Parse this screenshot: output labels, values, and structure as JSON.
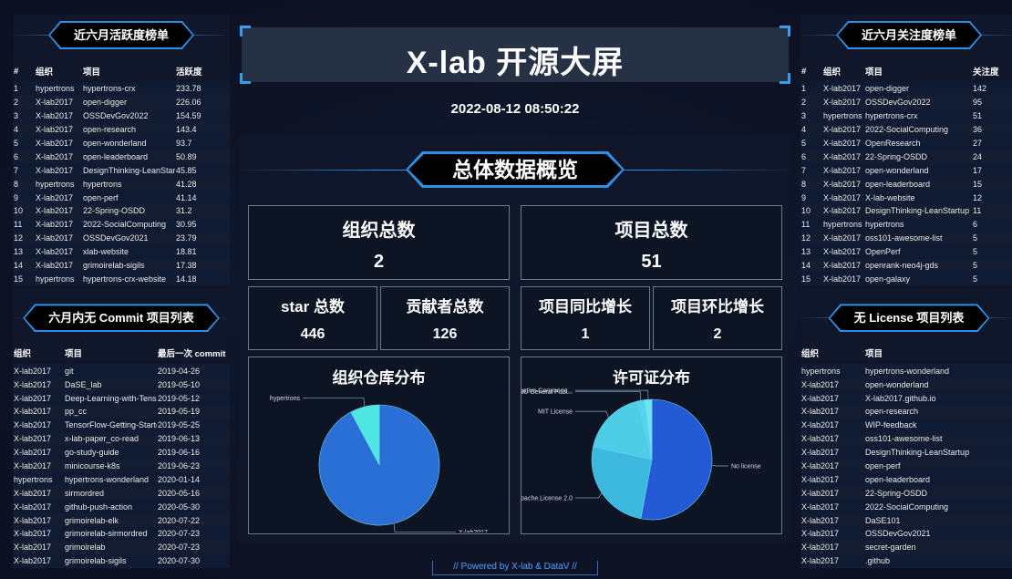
{
  "header": {
    "title": "X-lab 开源大屏",
    "timestamp": "2022-08-12 08:50:22"
  },
  "activity_rank": {
    "title": "近六月活跃度榜单",
    "columns": [
      "#",
      "组织",
      "项目",
      "活跃度"
    ],
    "rows": [
      [
        "1",
        "hypertrons",
        "hypertrons-crx",
        "233.78"
      ],
      [
        "2",
        "X-lab2017",
        "open-digger",
        "226.06"
      ],
      [
        "3",
        "X-lab2017",
        "OSSDevGov2022",
        "154.59"
      ],
      [
        "4",
        "X-lab2017",
        "open-research",
        "143.4"
      ],
      [
        "5",
        "X-lab2017",
        "open-wonderland",
        "93.7"
      ],
      [
        "6",
        "X-lab2017",
        "open-leaderboard",
        "50.89"
      ],
      [
        "7",
        "X-lab2017",
        "DesignThinking-LeanStartup",
        "45.85"
      ],
      [
        "8",
        "hypertrons",
        "hypertrons",
        "41.28"
      ],
      [
        "9",
        "X-lab2017",
        "open-perf",
        "41.14"
      ],
      [
        "10",
        "X-lab2017",
        "22-Spring-OSDD",
        "31.2"
      ],
      [
        "11",
        "X-lab2017",
        "2022-SocialComputing",
        "30.95"
      ],
      [
        "12",
        "X-lab2017",
        "OSSDevGov2021",
        "23.79"
      ],
      [
        "13",
        "X-lab2017",
        "xlab-website",
        "18.81"
      ],
      [
        "14",
        "X-lab2017",
        "grimoirelab-sigils",
        "17.38"
      ],
      [
        "15",
        "hypertrons",
        "hypertrons-crx-website",
        "14.18"
      ]
    ]
  },
  "no_commit": {
    "title": "六月内无 Commit 项目列表",
    "columns": [
      "组织",
      "项目",
      "最后一次 commit"
    ],
    "rows": [
      [
        "X-lab2017",
        "git",
        "2019-04-26"
      ],
      [
        "X-lab2017",
        "DaSE_lab",
        "2019-05-10"
      ],
      [
        "X-lab2017",
        "Deep-Learning-with-TensorFlow",
        "2019-05-12"
      ],
      [
        "X-lab2017",
        "pp_cc",
        "2019-05-19"
      ],
      [
        "X-lab2017",
        "TensorFlow-Getting-Started",
        "2019-05-25"
      ],
      [
        "X-lab2017",
        "x-lab-paper_co-read",
        "2019-06-13"
      ],
      [
        "X-lab2017",
        "go-study-guide",
        "2019-06-16"
      ],
      [
        "X-lab2017",
        "minicourse-k8s",
        "2019-06-23"
      ],
      [
        "hypertrons",
        "hypertrons-wonderland",
        "2020-01-14"
      ],
      [
        "X-lab2017",
        "sirmordred",
        "2020-05-16"
      ],
      [
        "X-lab2017",
        "github-push-action",
        "2020-05-30"
      ],
      [
        "X-lab2017",
        "grimoirelab-elk",
        "2020-07-22"
      ],
      [
        "X-lab2017",
        "grimoirelab-sirmordred",
        "2020-07-23"
      ],
      [
        "X-lab2017",
        "grimoirelab",
        "2020-07-23"
      ],
      [
        "X-lab2017",
        "grimoirelab-sigils",
        "2020-07-30"
      ]
    ]
  },
  "attention_rank": {
    "title": "近六月关注度榜单",
    "columns": [
      "#",
      "组织",
      "项目",
      "关注度"
    ],
    "rows": [
      [
        "1",
        "X-lab2017",
        "open-digger",
        "142"
      ],
      [
        "2",
        "X-lab2017",
        "OSSDevGov2022",
        "95"
      ],
      [
        "3",
        "hypertrons",
        "hypertrons-crx",
        "51"
      ],
      [
        "4",
        "X-lab2017",
        "2022-SocialComputing",
        "36"
      ],
      [
        "5",
        "X-lab2017",
        "OpenResearch",
        "27"
      ],
      [
        "6",
        "X-lab2017",
        "22-Spring-OSDD",
        "24"
      ],
      [
        "7",
        "X-lab2017",
        "open-wonderland",
        "17"
      ],
      [
        "8",
        "X-lab2017",
        "open-leaderboard",
        "15"
      ],
      [
        "9",
        "X-lab2017",
        "X-lab-website",
        "12"
      ],
      [
        "10",
        "X-lab2017",
        "DesignThinking-LeanStartup",
        "11"
      ],
      [
        "11",
        "hypertrons",
        "hypertrons",
        "6"
      ],
      [
        "12",
        "X-lab2017",
        "oss101-awesome-list",
        "5"
      ],
      [
        "13",
        "X-lab2017",
        "OpenPerf",
        "5"
      ],
      [
        "14",
        "X-lab2017",
        "openrank-neo4j-gds",
        "5"
      ],
      [
        "15",
        "X-lab2017",
        "open-galaxy",
        "5"
      ]
    ]
  },
  "no_license": {
    "title": "无 License 项目列表",
    "columns": [
      "组织",
      "项目"
    ],
    "rows": [
      [
        "hypertrons",
        "hypertrons-wonderland"
      ],
      [
        "X-lab2017",
        "open-wonderland"
      ],
      [
        "X-lab2017",
        "X-lab2017.github.io"
      ],
      [
        "X-lab2017",
        "open-research"
      ],
      [
        "X-lab2017",
        "WIP-feedback"
      ],
      [
        "X-lab2017",
        "oss101-awesome-list"
      ],
      [
        "X-lab2017",
        "DesignThinking-LeanStartup"
      ],
      [
        "X-lab2017",
        "open-perf"
      ],
      [
        "X-lab2017",
        "open-leaderboard"
      ],
      [
        "X-lab2017",
        "22-Spring-OSDD"
      ],
      [
        "X-lab2017",
        "2022-SocialComputing"
      ],
      [
        "X-lab2017",
        "DaSE101"
      ],
      [
        "X-lab2017",
        "OSSDevGov2021"
      ],
      [
        "X-lab2017",
        "secret-garden"
      ],
      [
        "X-lab2017",
        ".github"
      ]
    ]
  },
  "overview": {
    "title": "总体数据概览",
    "org_total": {
      "label": "组织总数",
      "value": "2"
    },
    "repo_total": {
      "label": "项目总数",
      "value": "51"
    },
    "star_total": {
      "label": "star 总数",
      "value": "446"
    },
    "contributor_total": {
      "label": "贡献者总数",
      "value": "126"
    },
    "yoy_growth": {
      "label": "项目同比增长",
      "value": "1"
    },
    "mom_growth": {
      "label": "项目环比增长",
      "value": "2"
    },
    "org_dist_title": "组织仓库分布",
    "license_dist_title": "许可证分布"
  },
  "chart_data": [
    {
      "type": "pie",
      "title": "组织仓库分布",
      "categories": [
        "X-lab2017",
        "hypertrons"
      ],
      "values": [
        47,
        4
      ],
      "colors": [
        "#2a6fd6",
        "#4ee6e2"
      ]
    },
    {
      "type": "pie",
      "title": "许可证分布",
      "categories": [
        "No license",
        "Apache License 2.0",
        "MIT License",
        "GNU General Publ...",
        "Creative Commons..."
      ],
      "values": [
        27,
        13,
        9,
        1,
        1
      ],
      "colors": [
        "#2459d4",
        "#3db9e0",
        "#4dcde6",
        "#52d5ea",
        "#6fe3f0"
      ]
    }
  ],
  "footer": {
    "text": "// Powered by X-lab & DataV //"
  }
}
